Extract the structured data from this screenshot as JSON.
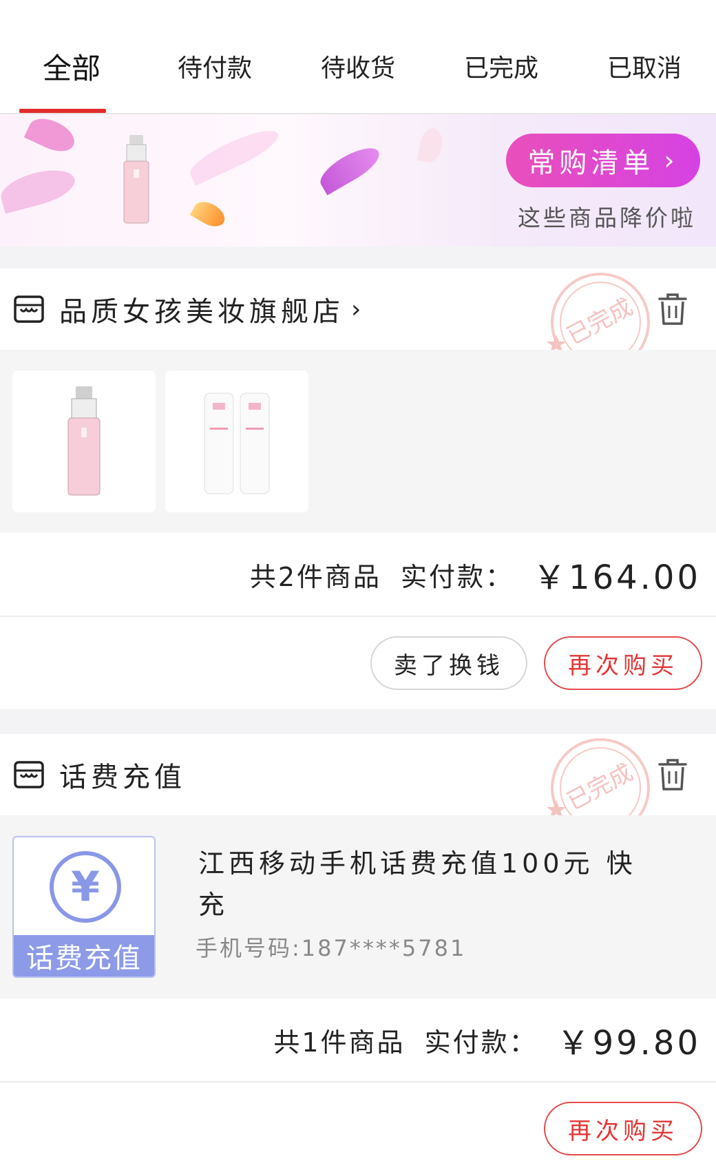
{
  "tabs": [
    {
      "label": "全部",
      "active": true
    },
    {
      "label": "待付款",
      "active": false
    },
    {
      "label": "待收货",
      "active": false
    },
    {
      "label": "已完成",
      "active": false
    },
    {
      "label": "已取消",
      "active": false
    }
  ],
  "banner": {
    "cta_label": "常购清单",
    "cta_chevron": "›",
    "subtitle": "这些商品降价啦"
  },
  "orders": [
    {
      "shop_name": "品质女孩美妆旗舰店",
      "shop_chevron": "›",
      "stamp_text": "已完成",
      "summary_count": "共2件商品",
      "summary_label": "实付款：",
      "price": "￥164.00",
      "buttons": {
        "sell": "卖了换钱",
        "rebuy": "再次购买"
      }
    },
    {
      "shop_name": "话费充值",
      "stamp_text": "已完成",
      "product_title": "江西移动手机话费充值100元 快充",
      "product_phone": "手机号码:187****5781",
      "product_image_label": "话费充值",
      "product_image_symbol": "¥",
      "summary_count": "共1件商品",
      "summary_label": "实付款：",
      "price": "￥99.80",
      "buttons": {
        "rebuy": "再次购买"
      }
    }
  ],
  "colors": {
    "accent_red": "#e22b2b",
    "banner_pink": "#e94fbb",
    "recharge_blue": "#8c9ae8"
  }
}
